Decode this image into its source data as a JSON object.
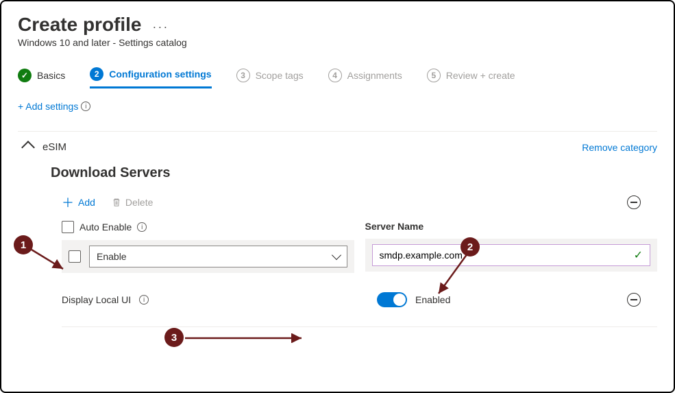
{
  "header": {
    "title": "Create profile",
    "subtitle": "Windows 10 and later - Settings catalog"
  },
  "steps": [
    {
      "label": "Basics",
      "state": "done"
    },
    {
      "num": "2",
      "label": "Configuration settings",
      "state": "active"
    },
    {
      "num": "3",
      "label": "Scope tags",
      "state": "pending"
    },
    {
      "num": "4",
      "label": "Assignments",
      "state": "pending"
    },
    {
      "num": "5",
      "label": "Review + create",
      "state": "pending"
    }
  ],
  "addSettings": "+ Add settings",
  "category": {
    "name": "eSIM",
    "remove": "Remove category"
  },
  "section": {
    "title": "Download Servers",
    "add": "Add",
    "delete": "Delete",
    "columns": {
      "autoEnable": "Auto Enable",
      "serverName": "Server Name"
    },
    "row": {
      "autoEnableValue": "Enable",
      "serverNameValue": "smdp.example.com"
    }
  },
  "displayLocal": {
    "label": "Display Local UI",
    "state": "Enabled"
  },
  "annotations": {
    "a1": "1",
    "a2": "2",
    "a3": "3"
  }
}
